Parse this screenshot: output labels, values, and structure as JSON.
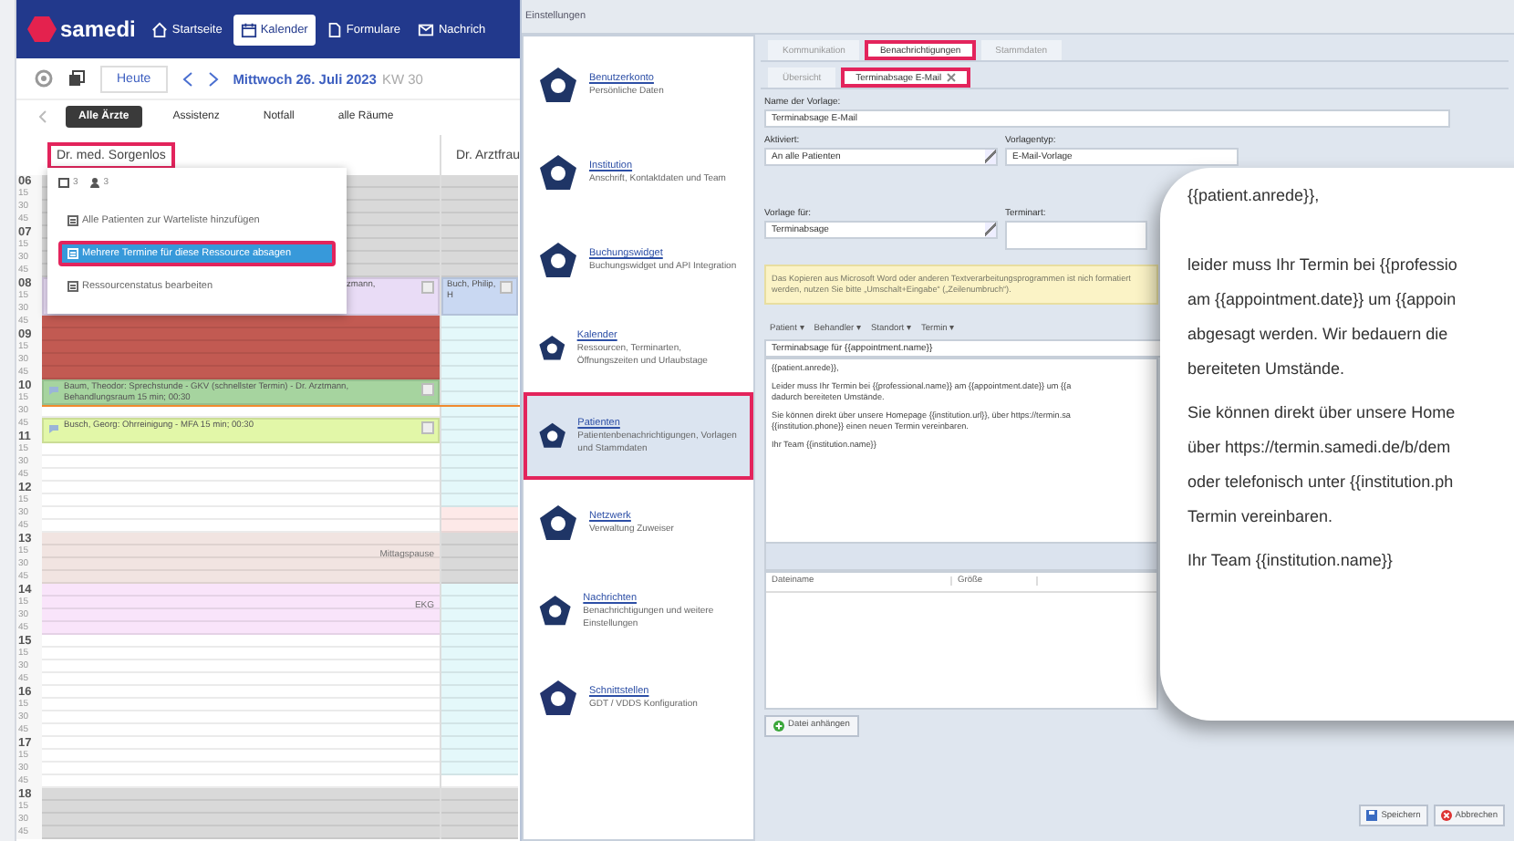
{
  "calendar_app": {
    "logo": "samedi",
    "nav": [
      {
        "label": "Startseite",
        "selected": false
      },
      {
        "label": "Kalender",
        "selected": true
      },
      {
        "label": "Formulare",
        "selected": false
      },
      {
        "label": "Nachrich",
        "selected": false
      }
    ],
    "today_button": "Heute",
    "date": "Mittwoch 26. Juli 2023",
    "week": "KW 30",
    "filters": [
      {
        "label": "Alle Ärzte",
        "selected": true
      },
      {
        "label": "Assistenz",
        "selected": false
      },
      {
        "label": "Notfall",
        "selected": false
      },
      {
        "label": "alle Räume",
        "selected": false
      }
    ],
    "columns": [
      {
        "name": "Dr. med. Sorgenlos",
        "highlighted": true
      },
      {
        "name": "Dr. Arztfrau",
        "highlighted": false
      }
    ],
    "slots": [
      {
        "time": "06",
        "now": false,
        "cells": [
          {
            "kind": "plain",
            "color": "#d9d9d9"
          },
          {
            "kind": "plain",
            "color": "#d9d9d9"
          }
        ]
      },
      {
        "time": "15",
        "now": false,
        "cells": [
          {
            "kind": "plain",
            "color": "#d9d9d9"
          },
          {
            "kind": "plain",
            "color": "#d9d9d9"
          }
        ]
      },
      {
        "time": "30",
        "now": false,
        "cells": [
          {
            "kind": "plain",
            "color": "#d9d9d9"
          },
          {
            "kind": "plain",
            "color": "#d9d9d9"
          }
        ]
      },
      {
        "time": "45",
        "now": false,
        "cells": [
          {
            "kind": "plain",
            "color": "#d9d9d9"
          },
          {
            "kind": "plain",
            "color": "#d9d9d9"
          }
        ]
      },
      {
        "time": "07",
        "now": false,
        "cells": [
          {
            "kind": "plain",
            "color": "#d9d9d9"
          },
          {
            "kind": "plain",
            "color": "#d9d9d9"
          }
        ]
      },
      {
        "time": "15",
        "now": false,
        "cells": [
          {
            "kind": "plain",
            "color": "#d9d9d9"
          },
          {
            "kind": "plain",
            "color": "#d9d9d9"
          }
        ]
      },
      {
        "time": "30",
        "now": false,
        "cells": [
          {
            "kind": "plain",
            "color": "#d9d9d9"
          },
          {
            "kind": "plain",
            "color": "#d9d9d9"
          }
        ]
      },
      {
        "time": "45",
        "now": false,
        "cells": [
          {
            "kind": "plain",
            "color": "#d9d9d9"
          },
          {
            "kind": "plain",
            "color": "#d9d9d9"
          }
        ]
      },
      {
        "time": "08",
        "now": false,
        "cells": [
          {
            "kind": "event-partial",
            "color": "#e9dcf6",
            "text": "zmann,"
          },
          {
            "kind": "event",
            "color": "#c9d8f2",
            "text": "Buch, Philip, H"
          }
        ]
      },
      {
        "time": "15",
        "now": false,
        "cells": [
          {
            "kind": "event-cont"
          },
          {
            "kind": "event-cont"
          }
        ]
      },
      {
        "time": "30",
        "now": false,
        "cells": [
          {
            "kind": "event-cont"
          },
          {
            "kind": "event-cont"
          }
        ]
      },
      {
        "time": "45",
        "now": false,
        "cells": [
          {
            "kind": "plain",
            "color": "#c25a52"
          },
          {
            "kind": "plain",
            "color": "#e4f8fa"
          }
        ]
      },
      {
        "time": "09",
        "now": false,
        "cells": [
          {
            "kind": "plain",
            "color": "#c25a52"
          },
          {
            "kind": "plain",
            "color": "#e4f8fa"
          }
        ]
      },
      {
        "time": "15",
        "now": false,
        "cells": [
          {
            "kind": "plain",
            "color": "#c25a52"
          },
          {
            "kind": "plain",
            "color": "#e4f8fa"
          }
        ]
      },
      {
        "time": "30",
        "now": false,
        "cells": [
          {
            "kind": "plain",
            "color": "#c25a52"
          },
          {
            "kind": "plain",
            "color": "#e4f8fa"
          }
        ]
      },
      {
        "time": "45",
        "now": false,
        "cells": [
          {
            "kind": "plain",
            "color": "#c25a52"
          },
          {
            "kind": "plain",
            "color": "#e4f8fa"
          }
        ]
      },
      {
        "time": "10",
        "now": false,
        "cells": [
          {
            "kind": "event",
            "color": "#a6d49f",
            "text": "Baum, Theodor: Sprechstunde - GKV (schnellster Termin) - Dr. Arztmann, Behandlungsraum 15 min; 00:30"
          },
          {
            "kind": "plain",
            "color": "#e4f8fa"
          }
        ]
      },
      {
        "time": "15",
        "now": false,
        "cells": [
          {
            "kind": "event-cont"
          },
          {
            "kind": "plain",
            "color": "#e4f8fa"
          }
        ]
      },
      {
        "time": "30",
        "now": true,
        "cells": [
          {
            "kind": "plain",
            "color": "#ffffff"
          },
          {
            "kind": "plain",
            "color": "#e4f8fa"
          }
        ]
      },
      {
        "time": "45",
        "now": false,
        "cells": [
          {
            "kind": "event",
            "color": "#e2f7a8",
            "text": "Busch, Georg: Ohrreinigung - MFA 15 min; 00:30"
          },
          {
            "kind": "plain",
            "color": "#e4f8fa"
          }
        ]
      },
      {
        "time": "11",
        "now": false,
        "cells": [
          {
            "kind": "event-cont"
          },
          {
            "kind": "plain",
            "color": "#e4f8fa"
          }
        ]
      },
      {
        "time": "15",
        "now": false,
        "cells": [
          {
            "kind": "plain",
            "color": "#ffffff"
          },
          {
            "kind": "plain",
            "color": "#e4f8fa"
          }
        ]
      },
      {
        "time": "30",
        "now": false,
        "cells": [
          {
            "kind": "plain",
            "color": "#ffffff"
          },
          {
            "kind": "plain",
            "color": "#e4f8fa"
          }
        ]
      },
      {
        "time": "45",
        "now": false,
        "cells": [
          {
            "kind": "plain",
            "color": "#ffffff"
          },
          {
            "kind": "plain",
            "color": "#e4f8fa"
          }
        ]
      },
      {
        "time": "12",
        "now": false,
        "cells": [
          {
            "kind": "plain",
            "color": "#ffffff"
          },
          {
            "kind": "plain",
            "color": "#e4f8fa"
          }
        ]
      },
      {
        "time": "15",
        "now": false,
        "cells": [
          {
            "kind": "plain",
            "color": "#ffffff"
          },
          {
            "kind": "plain",
            "color": "#e4f8fa"
          }
        ]
      },
      {
        "time": "30",
        "now": false,
        "cells": [
          {
            "kind": "plain",
            "color": "#ffffff"
          },
          {
            "kind": "plain",
            "color": "#fde9e8"
          }
        ]
      },
      {
        "time": "45",
        "now": false,
        "cells": [
          {
            "kind": "plain",
            "color": "#ffffff"
          },
          {
            "kind": "plain",
            "color": "#fde9e8"
          }
        ]
      },
      {
        "time": "13",
        "now": false,
        "cells": [
          {
            "kind": "label",
            "color": "#f1e4e1",
            "text": "Mittagspause"
          },
          {
            "kind": "plain",
            "color": "#d9d9d9"
          }
        ]
      },
      {
        "time": "15",
        "now": false,
        "cells": [
          {
            "kind": "plain",
            "color": "#f1e4e1"
          },
          {
            "kind": "plain",
            "color": "#d9d9d9"
          }
        ]
      },
      {
        "time": "30",
        "now": false,
        "cells": [
          {
            "kind": "plain",
            "color": "#f1e4e1"
          },
          {
            "kind": "plain",
            "color": "#d9d9d9"
          }
        ]
      },
      {
        "time": "45",
        "now": false,
        "cells": [
          {
            "kind": "plain",
            "color": "#f1e4e1"
          },
          {
            "kind": "plain",
            "color": "#d9d9d9"
          }
        ]
      },
      {
        "time": "14",
        "now": false,
        "cells": [
          {
            "kind": "label",
            "color": "#f9e4fa",
            "text": "EKG"
          },
          {
            "kind": "plain",
            "color": "#e4f8fa"
          }
        ]
      },
      {
        "time": "15",
        "now": false,
        "cells": [
          {
            "kind": "plain",
            "color": "#f9e4fa"
          },
          {
            "kind": "plain",
            "color": "#e4f8fa"
          }
        ]
      },
      {
        "time": "30",
        "now": false,
        "cells": [
          {
            "kind": "plain",
            "color": "#f9e4fa"
          },
          {
            "kind": "plain",
            "color": "#e4f8fa"
          }
        ]
      },
      {
        "time": "45",
        "now": false,
        "cells": [
          {
            "kind": "plain",
            "color": "#f9e4fa"
          },
          {
            "kind": "plain",
            "color": "#e4f8fa"
          }
        ]
      },
      {
        "time": "15",
        "now": false,
        "cells": [
          {
            "kind": "plain",
            "color": "#ffffff"
          },
          {
            "kind": "plain",
            "color": "#e4f8fa"
          }
        ]
      },
      {
        "time": "15",
        "now": false,
        "cells": [
          {
            "kind": "plain",
            "color": "#ffffff"
          },
          {
            "kind": "plain",
            "color": "#e4f8fa"
          }
        ]
      },
      {
        "time": "30",
        "now": false,
        "cells": [
          {
            "kind": "plain",
            "color": "#ffffff"
          },
          {
            "kind": "plain",
            "color": "#e4f8fa"
          }
        ]
      },
      {
        "time": "45",
        "now": false,
        "cells": [
          {
            "kind": "plain",
            "color": "#ffffff"
          },
          {
            "kind": "plain",
            "color": "#e4f8fa"
          }
        ]
      },
      {
        "time": "16",
        "now": false,
        "cells": [
          {
            "kind": "plain",
            "color": "#ffffff"
          },
          {
            "kind": "plain",
            "color": "#e4f8fa"
          }
        ]
      },
      {
        "time": "15",
        "now": false,
        "cells": [
          {
            "kind": "plain",
            "color": "#ffffff"
          },
          {
            "kind": "plain",
            "color": "#e4f8fa"
          }
        ]
      },
      {
        "time": "30",
        "now": false,
        "cells": [
          {
            "kind": "plain",
            "color": "#ffffff"
          },
          {
            "kind": "plain",
            "color": "#e4f8fa"
          }
        ]
      },
      {
        "time": "45",
        "now": false,
        "cells": [
          {
            "kind": "plain",
            "color": "#ffffff"
          },
          {
            "kind": "plain",
            "color": "#e4f8fa"
          }
        ]
      },
      {
        "time": "17",
        "now": false,
        "cells": [
          {
            "kind": "plain",
            "color": "#ffffff"
          },
          {
            "kind": "plain",
            "color": "#e4f8fa"
          }
        ]
      },
      {
        "time": "15",
        "now": false,
        "cells": [
          {
            "kind": "plain",
            "color": "#ffffff"
          },
          {
            "kind": "plain",
            "color": "#e4f8fa"
          }
        ]
      },
      {
        "time": "30",
        "now": false,
        "cells": [
          {
            "kind": "plain",
            "color": "#ffffff"
          },
          {
            "kind": "plain",
            "color": "#e4f8fa"
          }
        ]
      },
      {
        "time": "45",
        "now": false,
        "cells": [
          {
            "kind": "plain",
            "color": "#ffffff"
          },
          {
            "kind": "plain",
            "color": "#ffffff"
          }
        ]
      },
      {
        "time": "18",
        "now": false,
        "cells": [
          {
            "kind": "plain",
            "color": "#d9d9d9"
          },
          {
            "kind": "plain",
            "color": "#d9d9d9"
          }
        ]
      },
      {
        "time": "15",
        "now": false,
        "cells": [
          {
            "kind": "plain",
            "color": "#d9d9d9"
          },
          {
            "kind": "plain",
            "color": "#d9d9d9"
          }
        ]
      },
      {
        "time": "30",
        "now": false,
        "cells": [
          {
            "kind": "plain",
            "color": "#d9d9d9"
          },
          {
            "kind": "plain",
            "color": "#d9d9d9"
          }
        ]
      },
      {
        "time": "45",
        "now": false,
        "cells": [
          {
            "kind": "plain",
            "color": "#d9d9d9"
          },
          {
            "kind": "plain",
            "color": "#d9d9d9"
          }
        ]
      }
    ],
    "popup": {
      "appointments_count": "3",
      "patients_count": "3",
      "items": [
        {
          "label": "Alle Patienten zur Warteliste hinzufügen",
          "selected": false,
          "highlighted": false
        },
        {
          "label": "Mehrere Termine für diese Ressource absagen",
          "selected": true,
          "highlighted": true
        },
        {
          "label": "Ressourcenstatus bearbeiten",
          "selected": false,
          "highlighted": false
        }
      ]
    }
  },
  "settings": {
    "title": "Einstellungen",
    "sections": [
      {
        "title": "Benutzerkonto",
        "description": "Persönliche Daten",
        "selected": false,
        "highlighted": false
      },
      {
        "title": "Institution",
        "description": "Anschrift, Kontaktdaten und Team",
        "selected": false,
        "highlighted": false
      },
      {
        "title": "Buchungswidget",
        "description": "Buchungswidget und API Integration",
        "selected": false,
        "highlighted": false
      },
      {
        "title": "Kalender",
        "description": "Ressourcen, Terminarten, Öffnungszeiten und Urlaubstage",
        "selected": false,
        "highlighted": false
      },
      {
        "title": "Patienten",
        "description": "Patientenbenachrichtigungen, Vorlagen und Stammdaten",
        "selected": true,
        "highlighted": true
      },
      {
        "title": "Netzwerk",
        "description": "Verwaltung Zuweiser",
        "selected": false,
        "highlighted": false
      },
      {
        "title": "Nachrichten",
        "description": "Benachrichtigungen und weitere Einstellungen",
        "selected": false,
        "highlighted": false
      },
      {
        "title": "Schnittstellen",
        "description": "GDT / VDDS Konfiguration",
        "selected": false,
        "highlighted": false
      }
    ],
    "tabs": [
      {
        "label": "Kommunikation",
        "selected": false,
        "highlighted": false
      },
      {
        "label": "Benachrichtigungen",
        "selected": true,
        "highlighted": true
      },
      {
        "label": "Stammdaten",
        "selected": false,
        "highlighted": false
      }
    ],
    "subtabs": [
      {
        "label": "Übersicht",
        "selected": false,
        "highlighted": false,
        "closable": false
      },
      {
        "label": "Terminabsage E-Mail",
        "selected": true,
        "highlighted": true,
        "closable": true
      }
    ],
    "form": {
      "name_label": "Name der Vorlage:",
      "name_value": "Terminabsage E-Mail",
      "active_label": "Aktiviert:",
      "active_value": "An alle Patienten",
      "type_label": "Vorlagentyp:",
      "type_value": "E-Mail-Vorlage",
      "for_label": "Vorlage für:",
      "for_value": "Terminabsage",
      "appt_type_label": "Terminart:",
      "warning": "Das Kopieren aus Microsoft Word oder anderen Textverarbeitungsprogrammen ist nich formatiert werden, nutzen Sie bitte „Umschalt+Eingabe“ („Zeilenumbruch“).",
      "placeholder_menus": [
        "Patient ▾",
        "Behandler ▾",
        "Standort ▾",
        "Termin ▾"
      ],
      "subject": "Terminabsage für {{appointment.name}}",
      "body": [
        [
          "{{patient.anrede}},"
        ],
        [
          "Leider muss Ihr Termin bei {{professional.name}} am {{appointment.date}} um {{a",
          "dadurch bereiteten Umstände."
        ],
        [
          "Sie können direkt über unsere Homepage {{institution.url}}, über https://termin.sa",
          "{{institution.phone}} einen neuen Termin vereinbaren."
        ],
        [
          "Ihr Team {{institution.name}}"
        ]
      ],
      "attachment_columns": [
        "Dateiname",
        "Größe"
      ],
      "attach_button": "Datei anhängen",
      "save_button": "Speichern",
      "cancel_button": "Abbrechen"
    }
  },
  "callout": {
    "paragraphs": [
      [
        "{{patient.anrede}},"
      ],
      [
        "leider muss Ihr Termin bei {{professio",
        "am {{appointment.date}} um {{appoin",
        "abgesagt werden. Wir bedauern die",
        "bereiteten Umstände."
      ],
      [
        "Sie können direkt über unsere Home",
        "über https://termin.samedi.de/b/dem",
        "oder telefonisch unter {{institution.ph",
        "Termin vereinbaren."
      ],
      [
        "Ihr Team {{institution.name}}"
      ]
    ]
  }
}
